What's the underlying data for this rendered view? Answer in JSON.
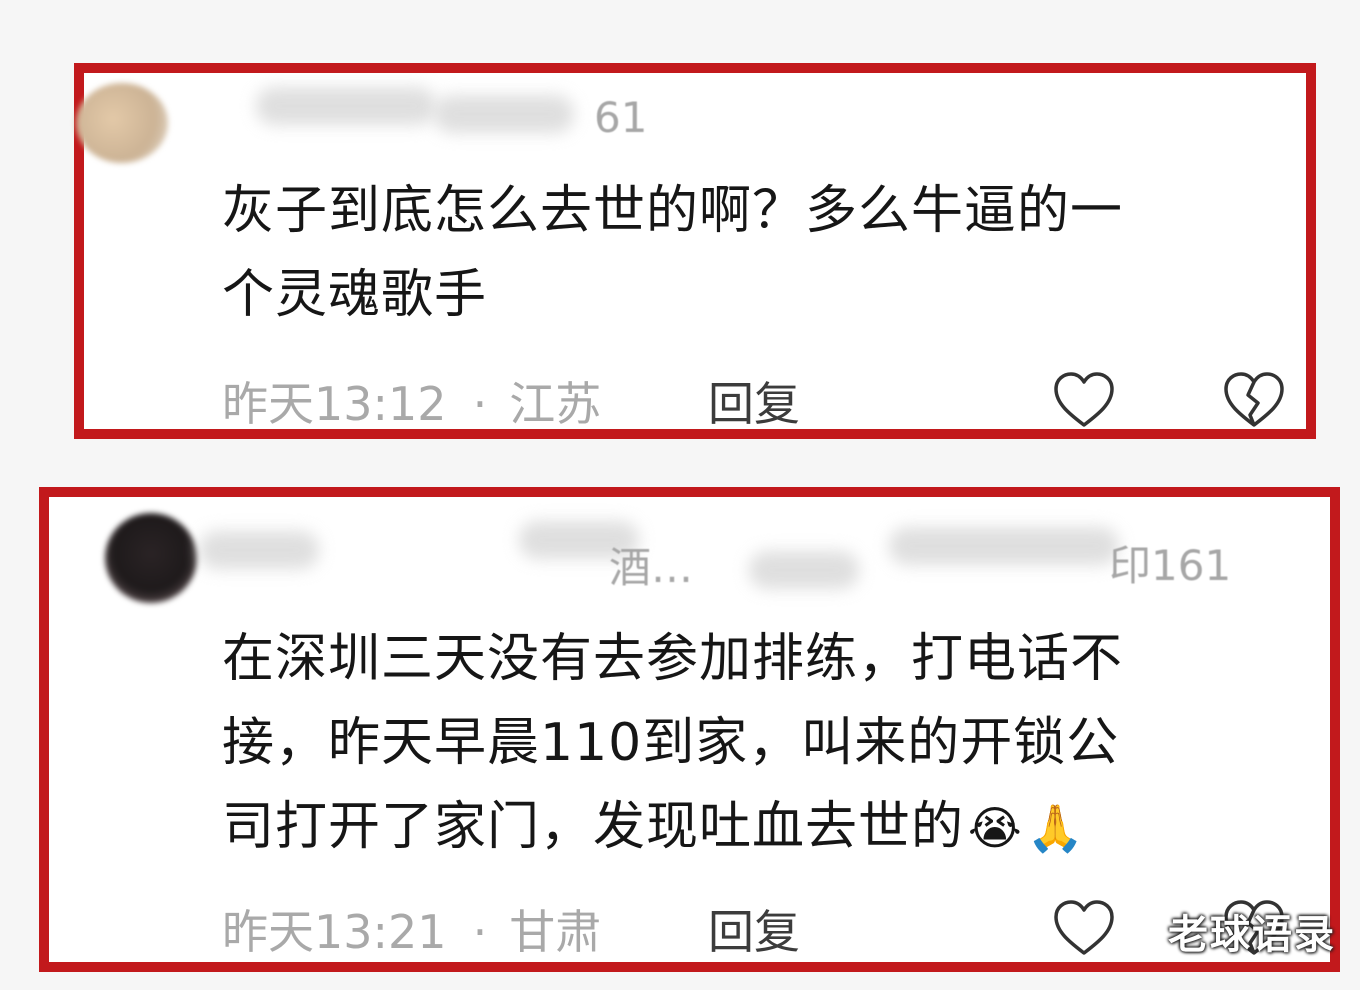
{
  "comments": [
    {
      "username_fragment": "61",
      "text_lines": [
        "灰子到底怎么去世的啊？多么牛逼的一",
        "个灵魂歌手"
      ],
      "emojis": [],
      "time": "昨天13:12",
      "separator": "·",
      "location": "江苏",
      "reply_label": "回复",
      "like_icon": "heart-outline-icon",
      "dislike_icon": "broken-heart-icon"
    },
    {
      "username_fragments": [
        "酒…",
        "印161"
      ],
      "text_lines": [
        "在深圳三天没有去参加排练，打电话不",
        "接，昨天早晨110到家，叫来的开锁公",
        "司打开了家门，发现吐血去世的"
      ],
      "emojis": [
        "😭",
        "🙏"
      ],
      "time": "昨天13:21",
      "separator": "·",
      "location": "甘肃",
      "reply_label": "回复",
      "like_icon": "heart-outline-icon",
      "dislike_icon": "broken-heart-icon"
    }
  ],
  "watermark": "老球语录",
  "colors": {
    "highlight_border": "#c2191c",
    "meta_text": "#a9a9a9",
    "comment_text": "#161616",
    "reply_text": "#3c3c3c"
  }
}
